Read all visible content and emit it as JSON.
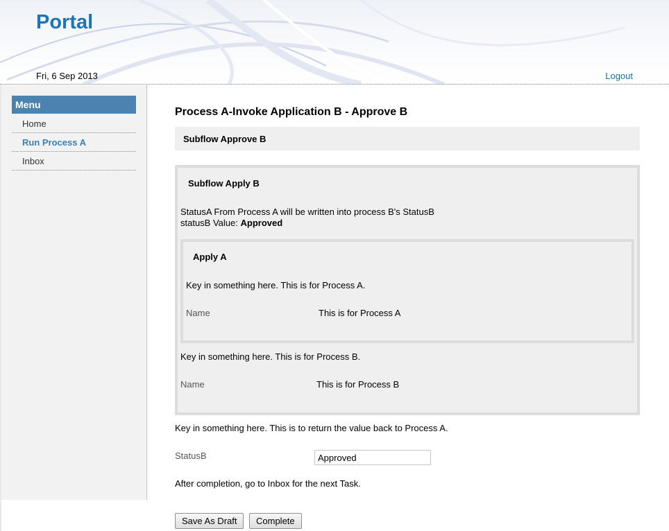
{
  "header": {
    "logo": "Portal",
    "date": "Fri, 6 Sep 2013",
    "logout_label": "Logout"
  },
  "sidebar": {
    "menu_title": "Menu",
    "items": [
      {
        "label": "Home",
        "active": false
      },
      {
        "label": "Run Process A",
        "active": true
      },
      {
        "label": "Inbox",
        "active": false
      }
    ]
  },
  "main": {
    "title": "Process A-Invoke Application B - Approve B",
    "subflow_approve": "Subflow Approve B",
    "subflow_apply": {
      "title": "Subflow Apply B",
      "status_line": "StatusA From Process A will be written into process B's StatusB",
      "status_value_label": "statusB Value:",
      "status_value": "Approved",
      "apply_a": {
        "title": "Apply A",
        "instruction": "Key in something here. This is for Process A.",
        "name_label": "Name",
        "name_value": "This is for Process A"
      },
      "instruction_b": "Key in something here. This is for Process B.",
      "name_label": "Name",
      "name_value": "This is for Process B"
    },
    "return_instruction": "Key in something here. This is to return the value back to Process A.",
    "statusb_label": "StatusB",
    "statusb_value": "Approved",
    "completion_note": "After completion, go to Inbox for the next Task.",
    "buttons": {
      "save_draft": "Save As Draft",
      "complete": "Complete"
    }
  },
  "colors": {
    "brand": "#1a76b8",
    "menu_header": "#4a82b0",
    "active_link": "#3a7fb5"
  }
}
